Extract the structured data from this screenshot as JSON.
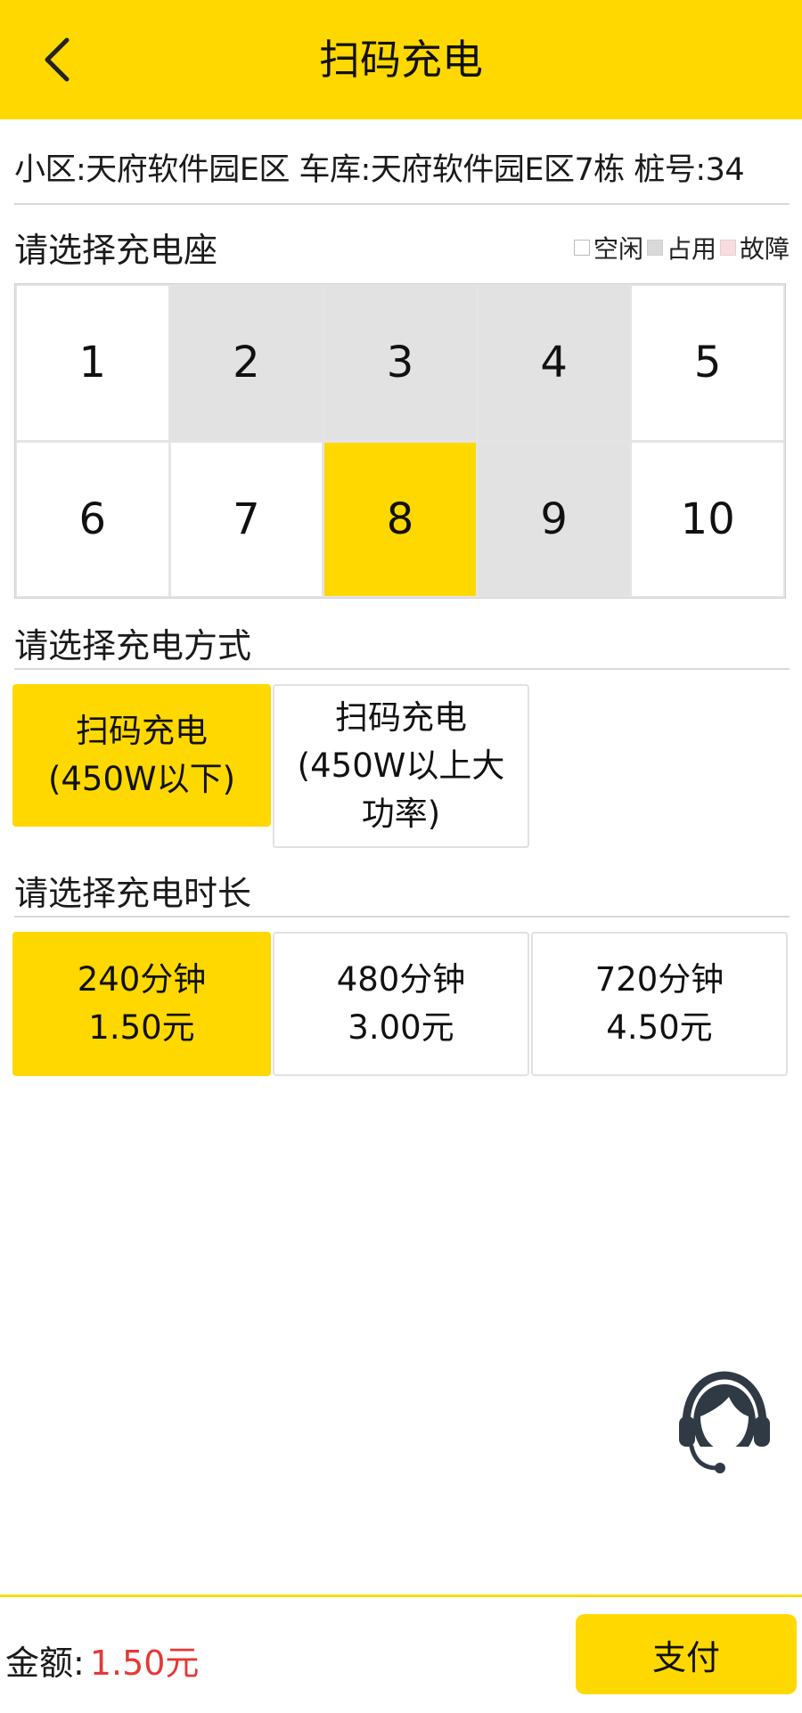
{
  "header": {
    "title": "扫码充电",
    "background": "#ffd800",
    "back_icon": "chevron-left-icon"
  },
  "location": {
    "text": "小区:天府软件园E区 车库:天府软件园E区7栋 桩号:34"
  },
  "socket_section": {
    "title": "请选择充电座",
    "legend": [
      {
        "label": "空闲",
        "color": "#ffffff"
      },
      {
        "label": "占用",
        "color": "#e2e2e2"
      },
      {
        "label": "故障",
        "color": "#f6dede"
      }
    ],
    "sockets": [
      {
        "label": "1",
        "status": "free"
      },
      {
        "label": "2",
        "status": "occupied"
      },
      {
        "label": "3",
        "status": "occupied"
      },
      {
        "label": "4",
        "status": "occupied"
      },
      {
        "label": "5",
        "status": "free"
      },
      {
        "label": "6",
        "status": "free"
      },
      {
        "label": "7",
        "status": "free"
      },
      {
        "label": "8",
        "status": "selected"
      },
      {
        "label": "9",
        "status": "occupied"
      },
      {
        "label": "10",
        "status": "free"
      }
    ]
  },
  "mode_section": {
    "title": "请选择充电方式",
    "options": [
      {
        "line1": "扫码充电",
        "line2": "(450W以下)",
        "line3": "",
        "selected": true
      },
      {
        "line1": "扫码充电",
        "line2": "(450W以上大",
        "line3": "功率)",
        "selected": false
      }
    ]
  },
  "duration_section": {
    "title": "请选择充电时长",
    "options": [
      {
        "line1": "240分钟",
        "line2": "1.50元",
        "selected": true
      },
      {
        "line1": "480分钟",
        "line2": "3.00元",
        "selected": false
      },
      {
        "line1": "720分钟",
        "line2": "4.50元",
        "selected": false
      }
    ]
  },
  "support": {
    "icon": "customer-service-icon"
  },
  "footer": {
    "amount_label": "金额:",
    "amount_value": "1.50元",
    "amount_color": "#e53935",
    "pay_label": "支付"
  }
}
